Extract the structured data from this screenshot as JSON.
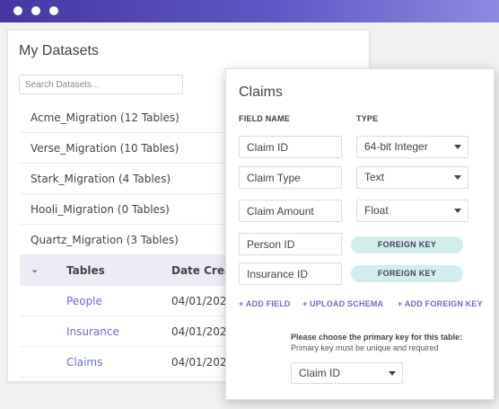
{
  "colors": {
    "accent": "#6a6bd6",
    "titlebar_start": "#4536a3",
    "titlebar_end": "#8c8be1",
    "foreign_key_badge": "#d3ecec",
    "tables_header_bg": "#ececf7"
  },
  "datasets": {
    "title": "My Datasets",
    "search_placeholder": "Search Datasets...",
    "items": [
      {
        "label": "Acme_Migration (12 Tables)"
      },
      {
        "label": "Verse_Migration (10 Tables)"
      },
      {
        "label": "Stark_Migration (4 Tables)"
      },
      {
        "label": "Hooli_Migration (0 Tables)"
      },
      {
        "label": "Quartz_Migration (3 Tables)"
      }
    ],
    "tables_header": {
      "icon": "chevron-down-icon",
      "tables": "Tables",
      "date": "Date Creat"
    },
    "tables": [
      {
        "name": "People",
        "date": "04/01/202"
      },
      {
        "name": "Insurance",
        "date": "04/01/202"
      },
      {
        "name": "Claims",
        "date": "04/01/202"
      }
    ]
  },
  "claims": {
    "title": "Claims",
    "field_name_header": "FIELD NAME",
    "type_header": "TYPE",
    "fields": [
      {
        "name": "Claim ID",
        "type": "64-bit Integer"
      },
      {
        "name": "Claim Type",
        "type": "Text"
      },
      {
        "name": "Claim Amount",
        "type": "Float"
      }
    ],
    "foreign_fields": [
      {
        "name": "Person ID",
        "badge": "FOREIGN KEY"
      },
      {
        "name": "Insurance ID",
        "badge": "FOREIGN KEY"
      }
    ],
    "actions": {
      "add_field": "+ ADD FIELD",
      "upload_schema": "+ UPLOAD SCHEMA",
      "add_foreign_key": "+ ADD FOREIGN KEY"
    },
    "primary_key": {
      "title": "Please choose the primary key for this table:",
      "subtitle": "Primary key must be unique and required",
      "selected": "Claim ID"
    }
  }
}
